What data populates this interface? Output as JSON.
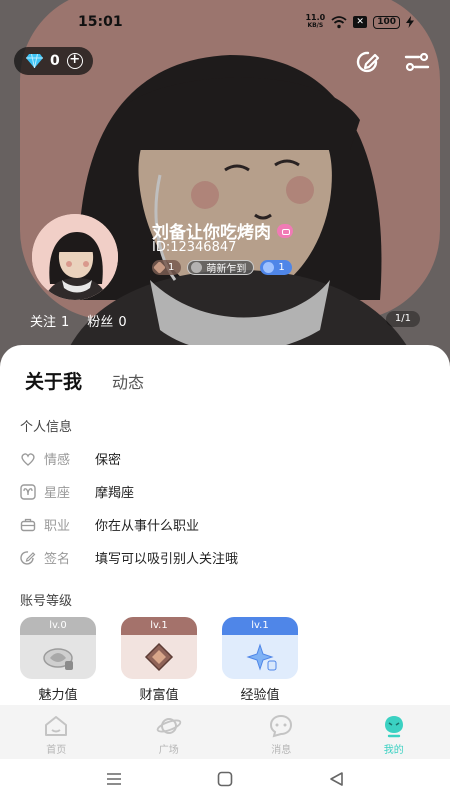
{
  "status_bar": {
    "time": "15:01",
    "net_speed": "11.0",
    "net_unit": "KB/S",
    "sim": "✕",
    "battery": "100"
  },
  "wallet": {
    "diamonds": "0"
  },
  "profile": {
    "name": "刘备让你吃烤肉",
    "id": "ID:12346847",
    "badges": {
      "wealth_level": "1",
      "charm_title": "萌新乍到",
      "exp_level": "1"
    },
    "following_label": "关注",
    "following_count": "1",
    "fans_label": "粉丝",
    "fans_count": "0",
    "photo_index": "1/1"
  },
  "tabs": [
    {
      "label": "关于我",
      "active": true
    },
    {
      "label": "动态",
      "active": false
    }
  ],
  "personal_info": {
    "title": "个人信息",
    "rows": [
      {
        "icon": "heart-icon",
        "label": "情感",
        "value": "保密"
      },
      {
        "icon": "aries-icon",
        "label": "星座",
        "value": "摩羯座"
      },
      {
        "icon": "briefcase-icon",
        "label": "职业",
        "value": "你在从事什么职业"
      },
      {
        "icon": "edit-icon",
        "label": "签名",
        "value": "填写可以吸引别人关注哦"
      }
    ]
  },
  "account_level": {
    "title": "账号等级",
    "cards": [
      {
        "level": "lv.0",
        "label": "魅力值",
        "color": "#b8b8b8"
      },
      {
        "level": "lv.1",
        "label": "财富值",
        "color": "#a4726b"
      },
      {
        "level": "lv.1",
        "label": "经验值",
        "color": "#4f86e8"
      }
    ]
  },
  "bottom_nav": [
    {
      "label": "首页",
      "icon": "home-icon",
      "active": false
    },
    {
      "label": "广场",
      "icon": "planet-icon",
      "active": false
    },
    {
      "label": "消息",
      "icon": "message-icon",
      "active": false
    },
    {
      "label": "我的",
      "icon": "profile-face-icon",
      "active": true
    }
  ],
  "colors": {
    "accent": "#3bd1c2",
    "chat_pink": "#f07bb5",
    "exp_blue": "#4f86e8"
  }
}
